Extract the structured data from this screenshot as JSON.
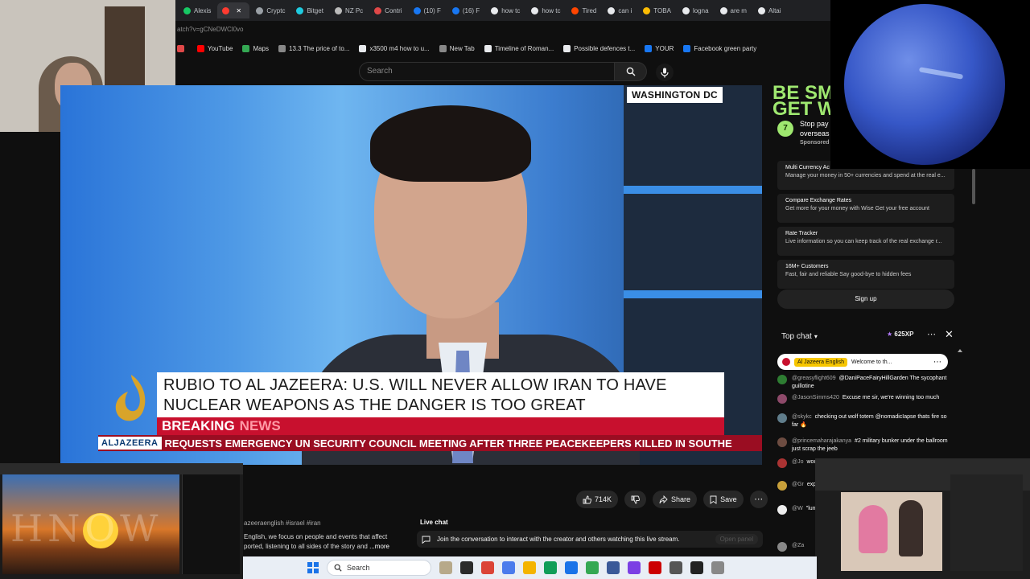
{
  "browser": {
    "tabs": [
      {
        "label": "Alexis",
        "color": "#17c964",
        "active": false
      },
      {
        "label": "",
        "color": "#ff3b30",
        "active": true
      },
      {
        "label": "Cryptc",
        "color": "#9aa0a6",
        "active": false
      },
      {
        "label": "Bitget",
        "color": "#1fcbe0",
        "active": false
      },
      {
        "label": "NZ Pc",
        "color": "#bbb",
        "active": false
      },
      {
        "label": "Contri",
        "color": "#e04848",
        "active": false
      },
      {
        "label": "(10) F",
        "color": "#1877f2",
        "active": false
      },
      {
        "label": "(16) F",
        "color": "#1877f2",
        "active": false
      },
      {
        "label": "how tc",
        "color": "#e8eaed",
        "active": false
      },
      {
        "label": "how tc",
        "color": "#e8eaed",
        "active": false
      },
      {
        "label": "Tired",
        "color": "#ff4500",
        "active": false
      },
      {
        "label": "can i",
        "color": "#e8eaed",
        "active": false
      },
      {
        "label": "TOBA",
        "color": "#fbbc04",
        "active": false
      },
      {
        "label": "logna",
        "color": "#e8eaed",
        "active": false
      },
      {
        "label": "are m",
        "color": "#e8eaed",
        "active": false
      },
      {
        "label": "Altai",
        "color": "#e8eaed",
        "active": false
      }
    ],
    "address": "atch?v=gCNeDWCl0vo",
    "bookmarks": [
      {
        "label": "",
        "color": "#e04848"
      },
      {
        "label": "YouTube",
        "color": "#ff0000"
      },
      {
        "label": "Maps",
        "color": "#34a853"
      },
      {
        "label": "13.3 The price of to...",
        "color": "#888"
      },
      {
        "label": "x3500 m4 how to u...",
        "color": "#e8eaed"
      },
      {
        "label": "New Tab",
        "color": "#888"
      },
      {
        "label": "Timeline of Roman...",
        "color": "#e8eaed"
      },
      {
        "label": "Possible defences t...",
        "color": "#e8eaed"
      },
      {
        "label": "YOUR",
        "color": "#1877f2"
      },
      {
        "label": "Facebook green party",
        "color": "#1877f2"
      }
    ]
  },
  "youtube": {
    "search_placeholder": "Search"
  },
  "video": {
    "location": "WASHINGTON DC",
    "headline": "RUBIO TO AL JAZEERA: U.S. WILL NEVER ALLOW IRAN TO HAVE NUCLEAR WEAPONS AS THE DANGER IS TOO GREAT",
    "breaking_1": "BREAKING",
    "breaking_2": "NEWS",
    "network": "ALJAZEERA",
    "ticker": "REQUESTS EMERGENCY UN SECURITY COUNCIL MEETING AFTER THREE PEACEKEEPERS KILLED IN SOUTHE"
  },
  "actions": {
    "likes": "714K",
    "share": "Share",
    "save": "Save"
  },
  "description": {
    "tags": "azeeraenglish #israel #iran",
    "line1": "English,  we focus on people and events that affect",
    "line2": "ported, listening to all sides of the story and",
    "more": "...more"
  },
  "live_chat": {
    "title": "Live chat",
    "join": "Join the conversation to interact with the creator and others watching this live stream.",
    "open": "Open panel"
  },
  "ad": {
    "banner": "BE SMA\nGET WI",
    "title_line1": "Stop pay",
    "title_line2": "overseas",
    "sponsored": "Sponsored",
    "cards": [
      {
        "title": "Multi Currency Ac",
        "sub": "Manage your money in 50+ currencies and spend at the real e..."
      },
      {
        "title": "Compare Exchange Rates",
        "sub": "Get more for your money with Wise Get your free account"
      },
      {
        "title": "Rate Tracker",
        "sub": "Live information so you can keep track of the real exchange r..."
      },
      {
        "title": "16M+ Customers",
        "sub": "Fast, fair and reliable Say good-bye to hidden fees"
      }
    ],
    "signup": "Sign up"
  },
  "chat": {
    "header": "Top chat",
    "xp": "625XP",
    "pinned_badge": "Al Jazeera English",
    "pinned_text": "Welcome to th...",
    "messages": [
      {
        "author": "@greasyflight609",
        "text": "@DaniPaceFairyHillGarden The sycophant guillotine",
        "color": "#2e7d32"
      },
      {
        "author": "@JasonSimms420",
        "text": "Excuse me sir, we're winning too much",
        "color": "#8e4a6a"
      },
      {
        "author": "@skykc",
        "text": "checking out wolf totem @nomadicIapse thats fire so far 🔥",
        "color": "#607d8b"
      },
      {
        "author": "@princemaharajakanya",
        "text": "#2 military bunker under the ballroom just scrap the jeeb",
        "color": "#6d4c41"
      },
      {
        "author": "@Jo",
        "text": "woul",
        "color": "#a33"
      },
      {
        "author": "@Gr",
        "text": "expe have",
        "color": "#c8a03a"
      },
      {
        "author": "@W",
        "text": "\"luna code what",
        "color": "#eee"
      },
      {
        "author": "@Za",
        "text": "",
        "color": "#888"
      }
    ]
  },
  "taskbar": {
    "search": "Search"
  }
}
